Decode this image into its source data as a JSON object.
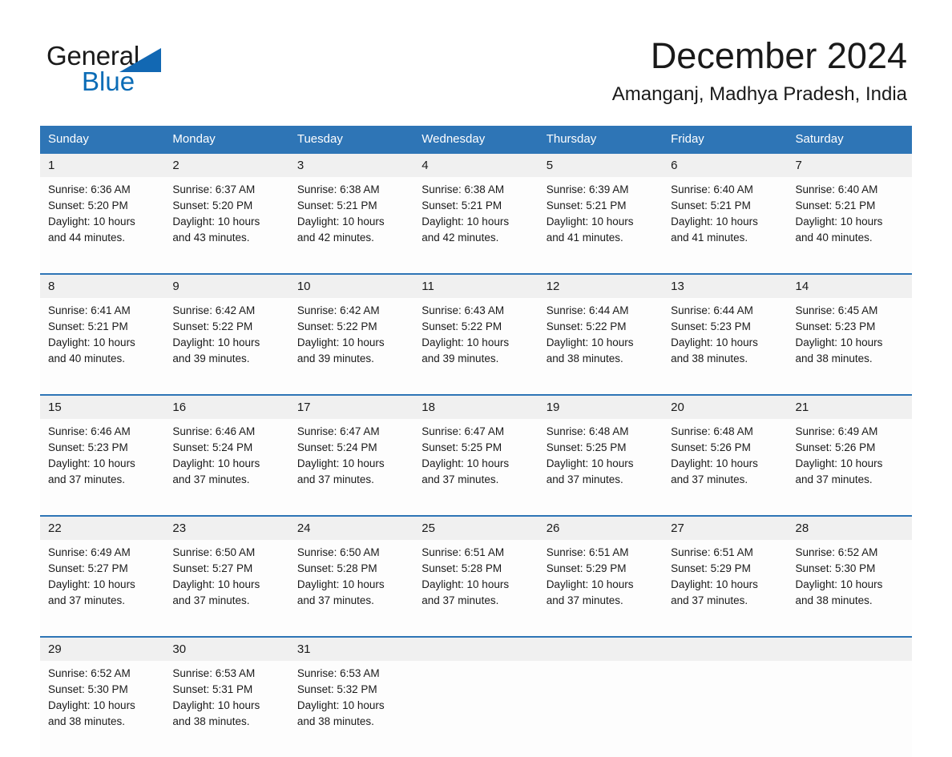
{
  "header": {
    "logo": {
      "word_one": "General",
      "word_two": "Blue",
      "triangle_color": "#1268b3",
      "blue_color": "#0b6cb6"
    },
    "month_title": "December 2024",
    "location": "Amanganj, Madhya Pradesh, India"
  },
  "calendar": {
    "header_bg": "#2e75b6",
    "daynum_bg": "#f0f0f0",
    "weekday_headers": [
      "Sunday",
      "Monday",
      "Tuesday",
      "Wednesday",
      "Thursday",
      "Friday",
      "Saturday"
    ],
    "weeks": [
      {
        "days": [
          {
            "num": "1",
            "sunrise": "Sunrise: 6:36 AM",
            "sunset": "Sunset: 5:20 PM",
            "daylight_1": "Daylight: 10 hours",
            "daylight_2": "and 44 minutes."
          },
          {
            "num": "2",
            "sunrise": "Sunrise: 6:37 AM",
            "sunset": "Sunset: 5:20 PM",
            "daylight_1": "Daylight: 10 hours",
            "daylight_2": "and 43 minutes."
          },
          {
            "num": "3",
            "sunrise": "Sunrise: 6:38 AM",
            "sunset": "Sunset: 5:21 PM",
            "daylight_1": "Daylight: 10 hours",
            "daylight_2": "and 42 minutes."
          },
          {
            "num": "4",
            "sunrise": "Sunrise: 6:38 AM",
            "sunset": "Sunset: 5:21 PM",
            "daylight_1": "Daylight: 10 hours",
            "daylight_2": "and 42 minutes."
          },
          {
            "num": "5",
            "sunrise": "Sunrise: 6:39 AM",
            "sunset": "Sunset: 5:21 PM",
            "daylight_1": "Daylight: 10 hours",
            "daylight_2": "and 41 minutes."
          },
          {
            "num": "6",
            "sunrise": "Sunrise: 6:40 AM",
            "sunset": "Sunset: 5:21 PM",
            "daylight_1": "Daylight: 10 hours",
            "daylight_2": "and 41 minutes."
          },
          {
            "num": "7",
            "sunrise": "Sunrise: 6:40 AM",
            "sunset": "Sunset: 5:21 PM",
            "daylight_1": "Daylight: 10 hours",
            "daylight_2": "and 40 minutes."
          }
        ]
      },
      {
        "days": [
          {
            "num": "8",
            "sunrise": "Sunrise: 6:41 AM",
            "sunset": "Sunset: 5:21 PM",
            "daylight_1": "Daylight: 10 hours",
            "daylight_2": "and 40 minutes."
          },
          {
            "num": "9",
            "sunrise": "Sunrise: 6:42 AM",
            "sunset": "Sunset: 5:22 PM",
            "daylight_1": "Daylight: 10 hours",
            "daylight_2": "and 39 minutes."
          },
          {
            "num": "10",
            "sunrise": "Sunrise: 6:42 AM",
            "sunset": "Sunset: 5:22 PM",
            "daylight_1": "Daylight: 10 hours",
            "daylight_2": "and 39 minutes."
          },
          {
            "num": "11",
            "sunrise": "Sunrise: 6:43 AM",
            "sunset": "Sunset: 5:22 PM",
            "daylight_1": "Daylight: 10 hours",
            "daylight_2": "and 39 minutes."
          },
          {
            "num": "12",
            "sunrise": "Sunrise: 6:44 AM",
            "sunset": "Sunset: 5:22 PM",
            "daylight_1": "Daylight: 10 hours",
            "daylight_2": "and 38 minutes."
          },
          {
            "num": "13",
            "sunrise": "Sunrise: 6:44 AM",
            "sunset": "Sunset: 5:23 PM",
            "daylight_1": "Daylight: 10 hours",
            "daylight_2": "and 38 minutes."
          },
          {
            "num": "14",
            "sunrise": "Sunrise: 6:45 AM",
            "sunset": "Sunset: 5:23 PM",
            "daylight_1": "Daylight: 10 hours",
            "daylight_2": "and 38 minutes."
          }
        ]
      },
      {
        "days": [
          {
            "num": "15",
            "sunrise": "Sunrise: 6:46 AM",
            "sunset": "Sunset: 5:23 PM",
            "daylight_1": "Daylight: 10 hours",
            "daylight_2": "and 37 minutes."
          },
          {
            "num": "16",
            "sunrise": "Sunrise: 6:46 AM",
            "sunset": "Sunset: 5:24 PM",
            "daylight_1": "Daylight: 10 hours",
            "daylight_2": "and 37 minutes."
          },
          {
            "num": "17",
            "sunrise": "Sunrise: 6:47 AM",
            "sunset": "Sunset: 5:24 PM",
            "daylight_1": "Daylight: 10 hours",
            "daylight_2": "and 37 minutes."
          },
          {
            "num": "18",
            "sunrise": "Sunrise: 6:47 AM",
            "sunset": "Sunset: 5:25 PM",
            "daylight_1": "Daylight: 10 hours",
            "daylight_2": "and 37 minutes."
          },
          {
            "num": "19",
            "sunrise": "Sunrise: 6:48 AM",
            "sunset": "Sunset: 5:25 PM",
            "daylight_1": "Daylight: 10 hours",
            "daylight_2": "and 37 minutes."
          },
          {
            "num": "20",
            "sunrise": "Sunrise: 6:48 AM",
            "sunset": "Sunset: 5:26 PM",
            "daylight_1": "Daylight: 10 hours",
            "daylight_2": "and 37 minutes."
          },
          {
            "num": "21",
            "sunrise": "Sunrise: 6:49 AM",
            "sunset": "Sunset: 5:26 PM",
            "daylight_1": "Daylight: 10 hours",
            "daylight_2": "and 37 minutes."
          }
        ]
      },
      {
        "days": [
          {
            "num": "22",
            "sunrise": "Sunrise: 6:49 AM",
            "sunset": "Sunset: 5:27 PM",
            "daylight_1": "Daylight: 10 hours",
            "daylight_2": "and 37 minutes."
          },
          {
            "num": "23",
            "sunrise": "Sunrise: 6:50 AM",
            "sunset": "Sunset: 5:27 PM",
            "daylight_1": "Daylight: 10 hours",
            "daylight_2": "and 37 minutes."
          },
          {
            "num": "24",
            "sunrise": "Sunrise: 6:50 AM",
            "sunset": "Sunset: 5:28 PM",
            "daylight_1": "Daylight: 10 hours",
            "daylight_2": "and 37 minutes."
          },
          {
            "num": "25",
            "sunrise": "Sunrise: 6:51 AM",
            "sunset": "Sunset: 5:28 PM",
            "daylight_1": "Daylight: 10 hours",
            "daylight_2": "and 37 minutes."
          },
          {
            "num": "26",
            "sunrise": "Sunrise: 6:51 AM",
            "sunset": "Sunset: 5:29 PM",
            "daylight_1": "Daylight: 10 hours",
            "daylight_2": "and 37 minutes."
          },
          {
            "num": "27",
            "sunrise": "Sunrise: 6:51 AM",
            "sunset": "Sunset: 5:29 PM",
            "daylight_1": "Daylight: 10 hours",
            "daylight_2": "and 37 minutes."
          },
          {
            "num": "28",
            "sunrise": "Sunrise: 6:52 AM",
            "sunset": "Sunset: 5:30 PM",
            "daylight_1": "Daylight: 10 hours",
            "daylight_2": "and 38 minutes."
          }
        ]
      },
      {
        "days": [
          {
            "num": "29",
            "sunrise": "Sunrise: 6:52 AM",
            "sunset": "Sunset: 5:30 PM",
            "daylight_1": "Daylight: 10 hours",
            "daylight_2": "and 38 minutes."
          },
          {
            "num": "30",
            "sunrise": "Sunrise: 6:53 AM",
            "sunset": "Sunset: 5:31 PM",
            "daylight_1": "Daylight: 10 hours",
            "daylight_2": "and 38 minutes."
          },
          {
            "num": "31",
            "sunrise": "Sunrise: 6:53 AM",
            "sunset": "Sunset: 5:32 PM",
            "daylight_1": "Daylight: 10 hours",
            "daylight_2": "and 38 minutes."
          },
          {
            "num": "",
            "sunrise": "",
            "sunset": "",
            "daylight_1": "",
            "daylight_2": ""
          },
          {
            "num": "",
            "sunrise": "",
            "sunset": "",
            "daylight_1": "",
            "daylight_2": ""
          },
          {
            "num": "",
            "sunrise": "",
            "sunset": "",
            "daylight_1": "",
            "daylight_2": ""
          },
          {
            "num": "",
            "sunrise": "",
            "sunset": "",
            "daylight_1": "",
            "daylight_2": ""
          }
        ]
      }
    ]
  }
}
